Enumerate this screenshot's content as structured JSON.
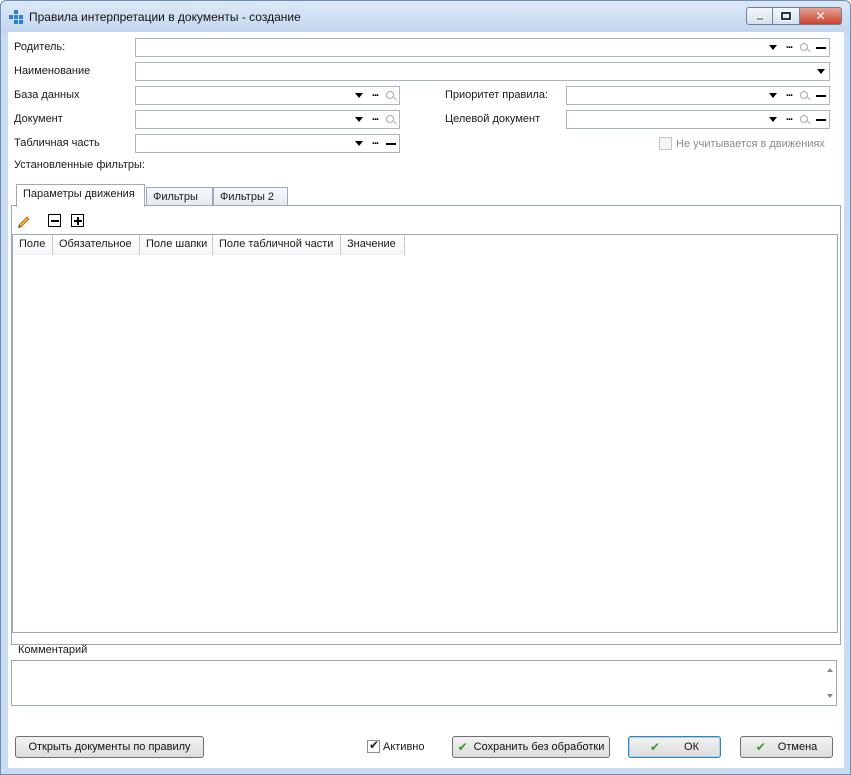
{
  "window": {
    "title": "Правила интерпретации в документы - создание"
  },
  "form": {
    "parent_label": "Родитель:",
    "name_label": "Наименование",
    "database_label": "База данных",
    "document_label": "Документ",
    "table_part_label": "Табличная часть",
    "priority_label": "Приоритет правила:",
    "target_doc_label": "Целевой документ",
    "not_counted_label": "Не учитывается в движениях",
    "filters_label": "Установленные фильтры:"
  },
  "tabs": [
    {
      "label": "Параметры движения",
      "active": true
    },
    {
      "label": "Фильтры",
      "active": false
    },
    {
      "label": "Фильтры 2",
      "active": false
    }
  ],
  "table": {
    "columns": [
      "Поле",
      "Обязательное",
      "Поле шапки",
      "Поле табличной части",
      "Значение"
    ],
    "rows": []
  },
  "comment": {
    "label": "Комментарий",
    "value": ""
  },
  "footer": {
    "open_docs_button": "Открыть документы по правилу",
    "active_label": "Активно",
    "active_checked": true,
    "save_no_process_button": "Сохранить без обработки",
    "ok_button": "ОК",
    "cancel_button": "Отмена"
  },
  "colors": {
    "window_frame": "#c9dcf1",
    "border": "#9aa8ba",
    "check_green": "#3a9a2a",
    "app_icon": "#2a7fd4"
  }
}
